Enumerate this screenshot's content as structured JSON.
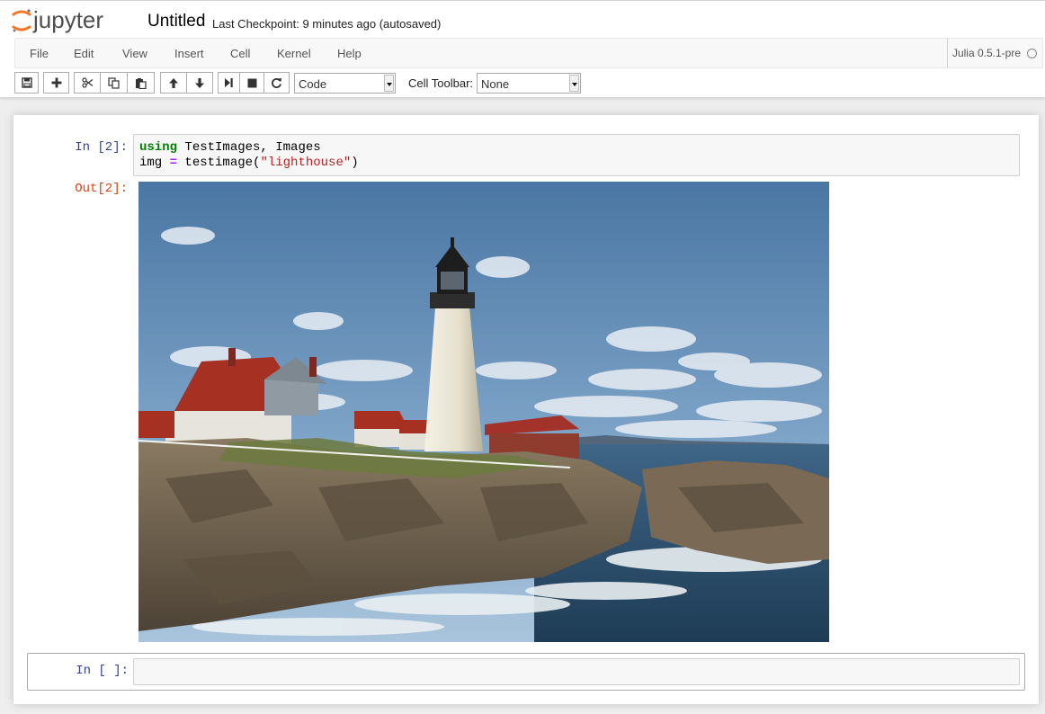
{
  "header": {
    "logo_text": "jupyter",
    "notebook_title": "Untitled",
    "checkpoint": "Last Checkpoint: 9 minutes ago (autosaved)"
  },
  "menu": {
    "items": [
      "File",
      "Edit",
      "View",
      "Insert",
      "Cell",
      "Kernel",
      "Help"
    ]
  },
  "kernel": {
    "name": "Julia 0.5.1-pre",
    "status_icon": "kernel-idle-circle-icon"
  },
  "toolbar": {
    "buttons": [
      {
        "icon": "save-icon"
      },
      {
        "icon": "plus-icon"
      },
      {
        "icon": "cut-icon"
      },
      {
        "icon": "copy-icon"
      },
      {
        "icon": "paste-icon"
      },
      {
        "icon": "arrow-up-icon"
      },
      {
        "icon": "arrow-down-icon"
      },
      {
        "icon": "step-forward-icon"
      },
      {
        "icon": "stop-icon"
      },
      {
        "icon": "restart-icon"
      }
    ],
    "cell_type": {
      "selected": "Code"
    },
    "cell_toolbar": {
      "label": "Cell Toolbar:",
      "selected": "None"
    }
  },
  "cells": {
    "cell1": {
      "in_prompt": "In [2]:",
      "code": {
        "line1_kw": "using",
        "line1_rest": " TestImages, Images",
        "line2_var": "img ",
        "line2_op": "=",
        "line2_call": " testimage(",
        "line2_str": "\"lighthouse\"",
        "line2_end": ")"
      },
      "out_prompt": "Out[2]:",
      "output": "lighthouse-photo"
    },
    "cell2": {
      "in_prompt": "In [ ]:",
      "code": ""
    }
  },
  "colors": {
    "in_prompt": "#303f9f",
    "out_prompt": "#d84315",
    "keyword": "#008000",
    "operator": "#aa22ff",
    "string": "#ba2121",
    "logo_orange": "#f37726"
  }
}
